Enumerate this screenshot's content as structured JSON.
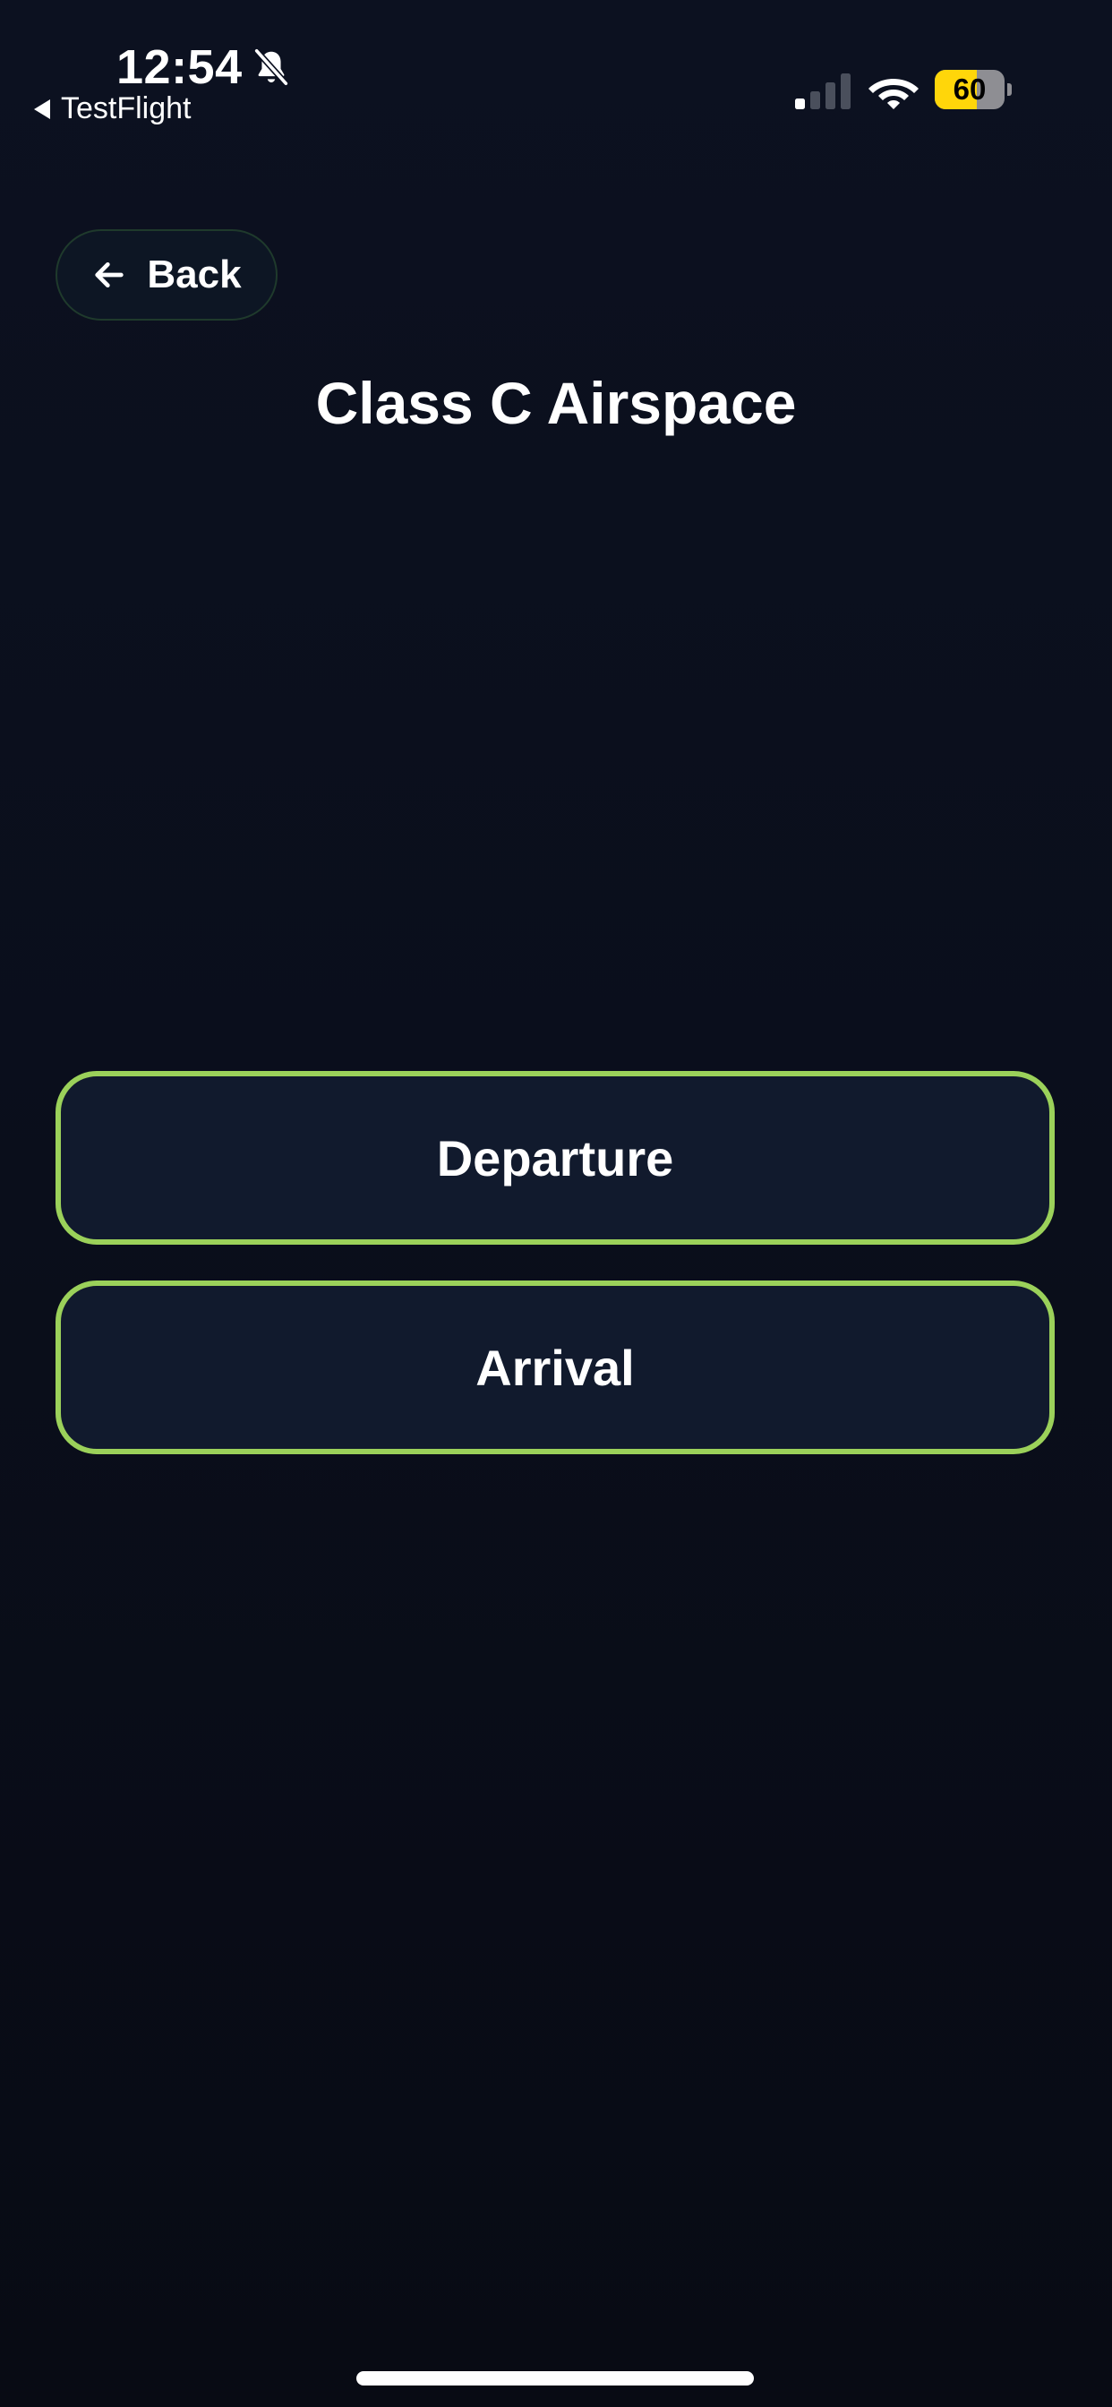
{
  "status_bar": {
    "time": "12:54",
    "back_app_label": "TestFlight",
    "battery_percent": 60,
    "battery_label": "60",
    "icons": {
      "silent": "bell-slash-icon",
      "signal": "cellular-signal-icon",
      "wifi": "wifi-icon",
      "battery": "battery-icon"
    }
  },
  "header": {
    "back_label": "Back",
    "back_icon": "arrow-left-icon",
    "title": "Class C Airspace"
  },
  "options": [
    {
      "label": "Departure"
    },
    {
      "label": "Arrival"
    }
  ],
  "colors": {
    "background": "#0a0e1b",
    "button_fill": "#111a2d",
    "accent_border": "#9bd15a",
    "battery_fill": "#ffd60a",
    "text": "#ffffff"
  }
}
